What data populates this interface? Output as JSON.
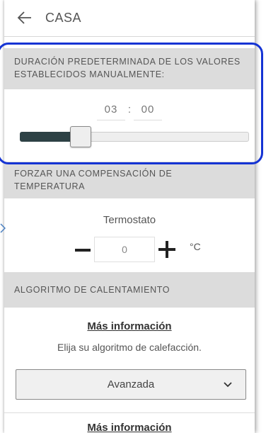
{
  "header": {
    "title": "CASA",
    "back_icon": "arrow-left-icon"
  },
  "duration": {
    "heading": "DURACIÓN PREDETERMINADA DE LOS VALORES ESTABLECIDOS MANUALMENTE:",
    "hours": "03",
    "separator": ":",
    "minutes": "00",
    "slider_fraction": 0.24,
    "slider_fill_color": "#2d4145"
  },
  "offset": {
    "heading": "FORZAR UNA COMPENSACIÓN DE TEMPERATURA",
    "label": "Termostato",
    "value": "0",
    "unit": "°C"
  },
  "algorithm": {
    "heading": "ALGORITMO DE CALENTAMIENTO",
    "more_info": "Más información",
    "prompt": "Elija su algoritmo de calefacción.",
    "selected": "Avanzada",
    "more_info_2": "Más información"
  },
  "colors": {
    "highlight": "#1534d4",
    "section_bg": "#dcdcdc"
  }
}
